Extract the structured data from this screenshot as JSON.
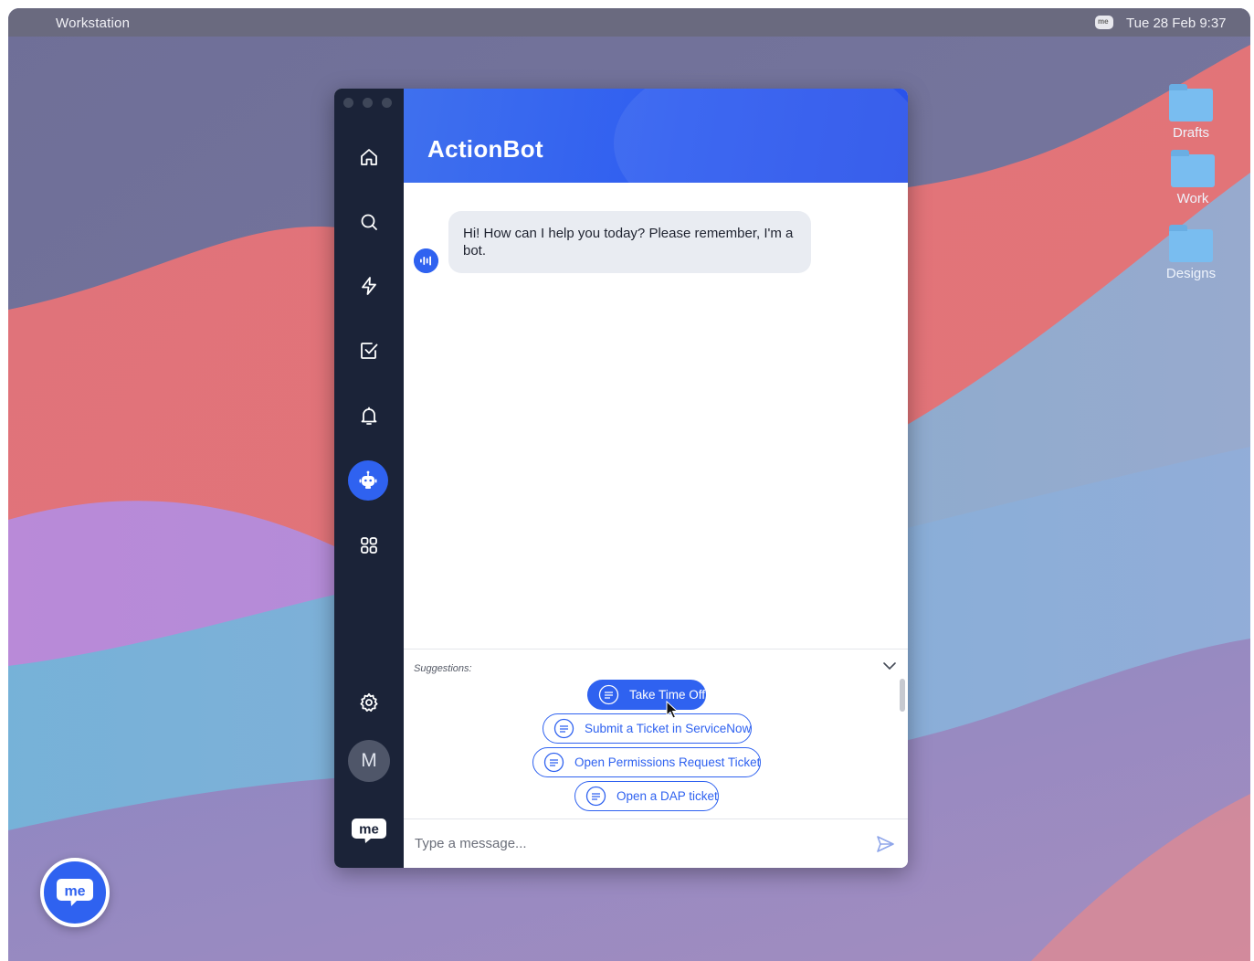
{
  "menubar": {
    "title": "Workstation",
    "tray_icon_text": "me",
    "clock": "Tue 28 Feb 9:37"
  },
  "desktop_folders": [
    {
      "label": "Drafts"
    },
    {
      "label": "Work"
    },
    {
      "label": "Designs"
    }
  ],
  "sidebar": {
    "items": [
      {
        "icon": "home-icon"
      },
      {
        "icon": "search-icon"
      },
      {
        "icon": "lightning-icon"
      },
      {
        "icon": "checkbox-icon"
      },
      {
        "icon": "bell-icon"
      },
      {
        "icon": "robot-icon",
        "active": true
      },
      {
        "icon": "grid-icon"
      },
      {
        "icon": "gear-icon"
      }
    ],
    "avatar_initial": "M",
    "logo": "me"
  },
  "header": {
    "title": "ActionBot"
  },
  "chat": {
    "messages": [
      {
        "from": "bot",
        "text": "Hi! How can I help you today? Please remember, I'm a bot."
      }
    ]
  },
  "suggestions": {
    "label": "Suggestions:",
    "items": [
      {
        "label": "Take Time Off",
        "selected": true
      },
      {
        "label": "Submit a Ticket in ServiceNow"
      },
      {
        "label": "Open Permissions Request Ticket"
      },
      {
        "label": "Open a DAP ticket"
      }
    ]
  },
  "composer": {
    "placeholder": "Type a message..."
  },
  "fab": {
    "logo": "me"
  },
  "colors": {
    "accent": "#2f62f0",
    "rail": "#1b2338",
    "bubble": "#e9ecf2"
  }
}
